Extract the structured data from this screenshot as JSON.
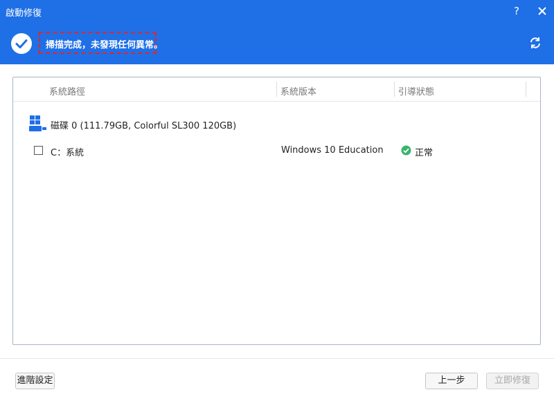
{
  "window": {
    "title": "啟動修復",
    "help_label": "?"
  },
  "banner": {
    "message": "掃描完成，未發現任何異常。"
  },
  "table": {
    "columns": [
      "系統路徑",
      "系統版本",
      "引導狀態"
    ],
    "disk": {
      "icon_badge": "SSD",
      "label": "磁碟 0 (111.79GB, Colorful SL300 120GB)"
    },
    "partitions": [
      {
        "checked": false,
        "label": "C：系統",
        "version": "Windows 10 Education",
        "status": "正常"
      }
    ]
  },
  "footer": {
    "advanced_label": "進階設定",
    "prev_label": "上一步",
    "fix_label": "立即修復"
  },
  "colors": {
    "primary_blue": "#1f6fe6",
    "highlight_red": "#e0262a",
    "ok_green": "#3bb36b"
  }
}
